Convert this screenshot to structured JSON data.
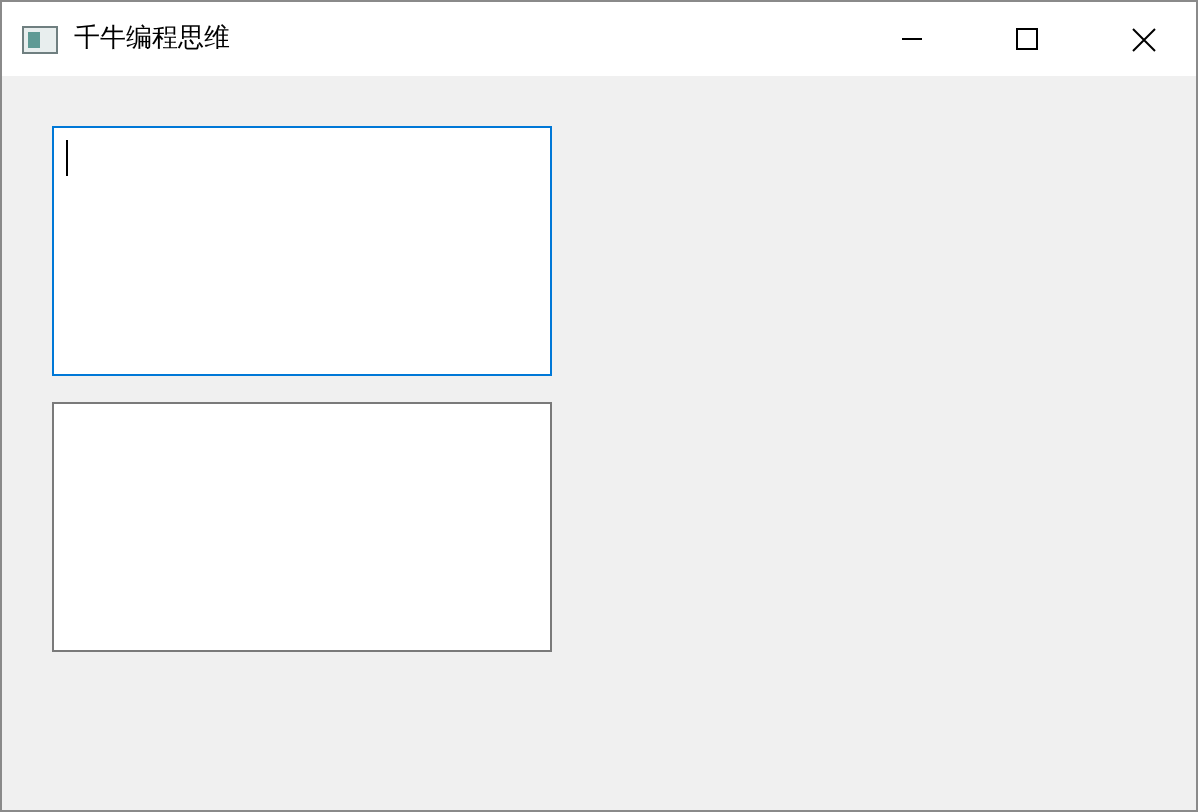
{
  "window": {
    "title": "千牛编程思维"
  },
  "text_boxes": [
    {
      "focused": true
    },
    {
      "focused": false
    }
  ]
}
